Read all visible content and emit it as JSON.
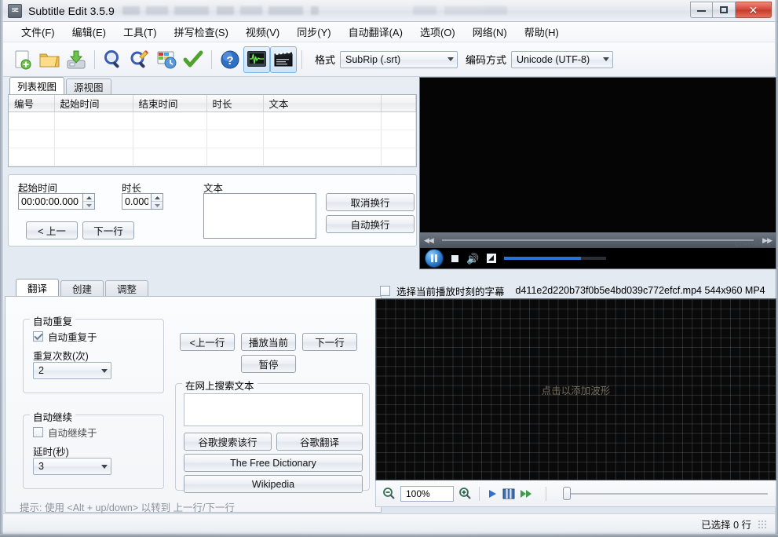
{
  "window": {
    "title": "Subtitle Edit 3.5.9",
    "app_icon": "SE",
    "minimize_label": "—",
    "maximize_label": "□",
    "close_label": "✕"
  },
  "menubar": {
    "items": [
      {
        "label": "文件(F)",
        "name": "menu-file"
      },
      {
        "label": "编辑(E)",
        "name": "menu-edit"
      },
      {
        "label": "工具(T)",
        "name": "menu-tools"
      },
      {
        "label": "拼写检查(S)",
        "name": "menu-spellcheck"
      },
      {
        "label": "视频(V)",
        "name": "menu-video"
      },
      {
        "label": "同步(Y)",
        "name": "menu-sync"
      },
      {
        "label": "自动翻译(A)",
        "name": "menu-autotranslate"
      },
      {
        "label": "选项(O)",
        "name": "menu-options"
      },
      {
        "label": "网络(N)",
        "name": "menu-network"
      },
      {
        "label": "帮助(H)",
        "name": "menu-help"
      }
    ]
  },
  "toolbar": {
    "buttons": [
      {
        "name": "new-icon",
        "title": "新建"
      },
      {
        "name": "open-folder-icon",
        "title": "打开"
      },
      {
        "name": "save-icon",
        "title": "保存"
      },
      {
        "name": "find-icon",
        "title": "查找"
      },
      {
        "name": "replace-icon",
        "title": "替换"
      },
      {
        "name": "sync-time-icon",
        "title": "可视化同步"
      },
      {
        "name": "checkmark-icon",
        "title": "修复常见错误"
      },
      {
        "name": "help-icon",
        "title": "帮助"
      },
      {
        "name": "waveform-toggle-icon",
        "title": "显示波形"
      },
      {
        "name": "video-toggle-icon",
        "title": "显示视频"
      }
    ],
    "format_label": "格式",
    "format_value": "SubRip (.srt)",
    "encoding_label": "编码方式",
    "encoding_value": "Unicode (UTF-8)"
  },
  "list_tabs": [
    {
      "label": "列表视图",
      "selected": true
    },
    {
      "label": "源视图",
      "selected": false
    }
  ],
  "subtitle_table": {
    "columns": [
      "编号",
      "起始时间",
      "结束时间",
      "时长",
      "文本"
    ],
    "rows": []
  },
  "editor": {
    "start_time_label": "起始时间",
    "start_time_value": "00:00:00.000",
    "duration_label": "时长",
    "duration_value": "0.000",
    "text_label": "文本",
    "text_value": "",
    "unbreak_button": "取消换行",
    "autobreak_button": "自动换行",
    "prev_button": "< 上一",
    "next_button": "下一行"
  },
  "bottom_tabs": [
    {
      "label": "翻译",
      "selected": true
    },
    {
      "label": "创建",
      "selected": false
    },
    {
      "label": "调整",
      "selected": false
    }
  ],
  "translate_panel": {
    "auto_repeat_group": "自动重复",
    "auto_repeat_checkbox": "自动重复于",
    "auto_repeat_checked": true,
    "repeat_count_label": "重复次数(次)",
    "repeat_count_value": "2",
    "auto_continue_group": "自动继续",
    "auto_continue_checkbox": "自动继续于",
    "auto_continue_checked": false,
    "delay_label": "延时(秒)",
    "delay_value": "3",
    "prev_line_button": "<上一行",
    "play_current_button": "播放当前",
    "next_line_button": "下一行",
    "pause_button": "暂停",
    "search_group": "在网上搜索文本",
    "search_value": "",
    "google_search_button": "谷歌搜索该行",
    "google_translate_button": "谷歌翻译",
    "free_dictionary_button": "The Free Dictionary",
    "wikipedia_button": "Wikipedia",
    "hint": "提示: 使用 <Alt + up/down> 以转到 上一行/下一行"
  },
  "video": {
    "renderer_label": "DirectShow",
    "volume_percent": 75,
    "seek_position_percent": 0
  },
  "select_subtitle_row": {
    "checkbox_label": "选择当前播放时刻的字幕",
    "checked": false,
    "file_info": "d411e2d220b73f0b5e4bd039c772efcf.mp4 544x960 MP4"
  },
  "waveform": {
    "hint": "点击以添加波形",
    "zoom_value": "100%",
    "slider_position_percent": 0
  },
  "statusbar": {
    "text": "已选择 0 行"
  },
  "colors": {
    "accent": "#2b6fdb",
    "title_close": "#d4483a",
    "tab_selected_bg": "#ffffff",
    "waveform_bg": "#0a0a0a",
    "video_bg": "#050505",
    "hint_text": "#8a8371"
  }
}
